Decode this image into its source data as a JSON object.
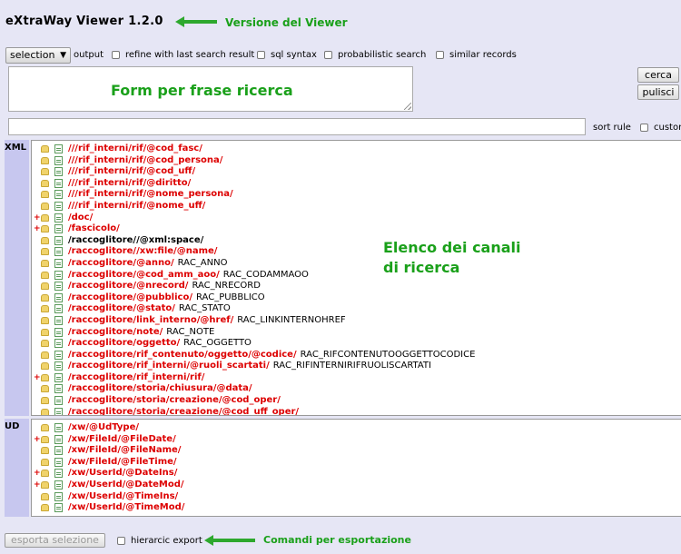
{
  "header": {
    "title": "eXtraWay Viewer 1.2.0",
    "version_annotation": "Versione del Viewer"
  },
  "options": {
    "selection_value": "selection",
    "output_label": "output",
    "refine_label": "refine with last search result",
    "sql_label": "sql syntax",
    "prob_label": "probabilistic search",
    "similar_label": "similar records"
  },
  "query": {
    "annotation": "Form per frase ricerca",
    "search_button": "cerca",
    "clear_button": "pulisci"
  },
  "sort": {
    "sort_rule_label": "sort rule",
    "custom_label": "custon"
  },
  "xml_panel": {
    "label": "XML",
    "annotation_line1": "Elenco dei canali",
    "annotation_line2": "di ricerca",
    "items": [
      {
        "path": "///rif_interni/rif/@cod_fasc/",
        "alias": "",
        "plus": false,
        "red": true
      },
      {
        "path": "///rif_interni/rif/@cod_persona/",
        "alias": "",
        "plus": false,
        "red": true
      },
      {
        "path": "///rif_interni/rif/@cod_uff/",
        "alias": "",
        "plus": false,
        "red": true
      },
      {
        "path": "///rif_interni/rif/@diritto/",
        "alias": "",
        "plus": false,
        "red": true
      },
      {
        "path": "///rif_interni/rif/@nome_persona/",
        "alias": "",
        "plus": false,
        "red": true
      },
      {
        "path": "///rif_interni/rif/@nome_uff/",
        "alias": "",
        "plus": false,
        "red": true
      },
      {
        "path": "/doc/",
        "alias": "",
        "plus": true,
        "red": true
      },
      {
        "path": "/fascicolo/",
        "alias": "",
        "plus": true,
        "red": true
      },
      {
        "path": "/raccoglitore//@xml:space/",
        "alias": "",
        "plus": false,
        "red": false
      },
      {
        "path": "/raccoglitore//xw:file/@name/",
        "alias": "",
        "plus": false,
        "red": true
      },
      {
        "path": "/raccoglitore/@anno/",
        "alias": "RAC_ANNO",
        "plus": false,
        "red": true
      },
      {
        "path": "/raccoglitore/@cod_amm_aoo/",
        "alias": "RAC_CODAMMAOO",
        "plus": false,
        "red": true
      },
      {
        "path": "/raccoglitore/@nrecord/",
        "alias": "RAC_NRECORD",
        "plus": false,
        "red": true
      },
      {
        "path": "/raccoglitore/@pubblico/",
        "alias": "RAC_PUBBLICO",
        "plus": false,
        "red": true
      },
      {
        "path": "/raccoglitore/@stato/",
        "alias": "RAC_STATO",
        "plus": false,
        "red": true
      },
      {
        "path": "/raccoglitore/link_interno/@href/",
        "alias": "RAC_LINKINTERNOHREF",
        "plus": false,
        "red": true
      },
      {
        "path": "/raccoglitore/note/",
        "alias": "RAC_NOTE",
        "plus": false,
        "red": true
      },
      {
        "path": "/raccoglitore/oggetto/",
        "alias": "RAC_OGGETTO",
        "plus": false,
        "red": true
      },
      {
        "path": "/raccoglitore/rif_contenuto/oggetto/@codice/",
        "alias": "RAC_RIFCONTENUTOOGGETTOCODICE",
        "plus": false,
        "red": true
      },
      {
        "path": "/raccoglitore/rif_interni/@ruoli_scartati/",
        "alias": "RAC_RIFINTERNIRIFRUOLISCARTATI",
        "plus": false,
        "red": true
      },
      {
        "path": "/raccoglitore/rif_interni/rif/",
        "alias": "",
        "plus": true,
        "red": true
      },
      {
        "path": "/raccoglitore/storia/chiusura/@data/",
        "alias": "",
        "plus": false,
        "red": true
      },
      {
        "path": "/raccoglitore/storia/creazione/@cod_oper/",
        "alias": "",
        "plus": false,
        "red": true
      },
      {
        "path": "/raccoglitore/storia/creazione/@cod_uff_oper/",
        "alias": "",
        "plus": false,
        "red": true
      }
    ]
  },
  "ud_panel": {
    "label": "UD",
    "items": [
      {
        "path": "/xw/@UdType/",
        "plus": false
      },
      {
        "path": "/xw/FileId/@FileDate/",
        "plus": true
      },
      {
        "path": "/xw/FileId/@FileName/",
        "plus": false
      },
      {
        "path": "/xw/FileId/@FileTime/",
        "plus": false
      },
      {
        "path": "/xw/UserId/@DateIns/",
        "plus": true
      },
      {
        "path": "/xw/UserId/@DateMod/",
        "plus": true
      },
      {
        "path": "/xw/UserId/@TimeIns/",
        "plus": false
      },
      {
        "path": "/xw/UserId/@TimeMod/",
        "plus": false
      }
    ]
  },
  "footer": {
    "export_button": "esporta selezione",
    "hierarchic_label": "hierarcic export",
    "annotation": "Comandi per esportazione"
  },
  "colors": {
    "annotation": "#1aa01a",
    "path_red": "#dd0000",
    "strip": "#c7c7ef",
    "background": "#e6e6f5"
  }
}
